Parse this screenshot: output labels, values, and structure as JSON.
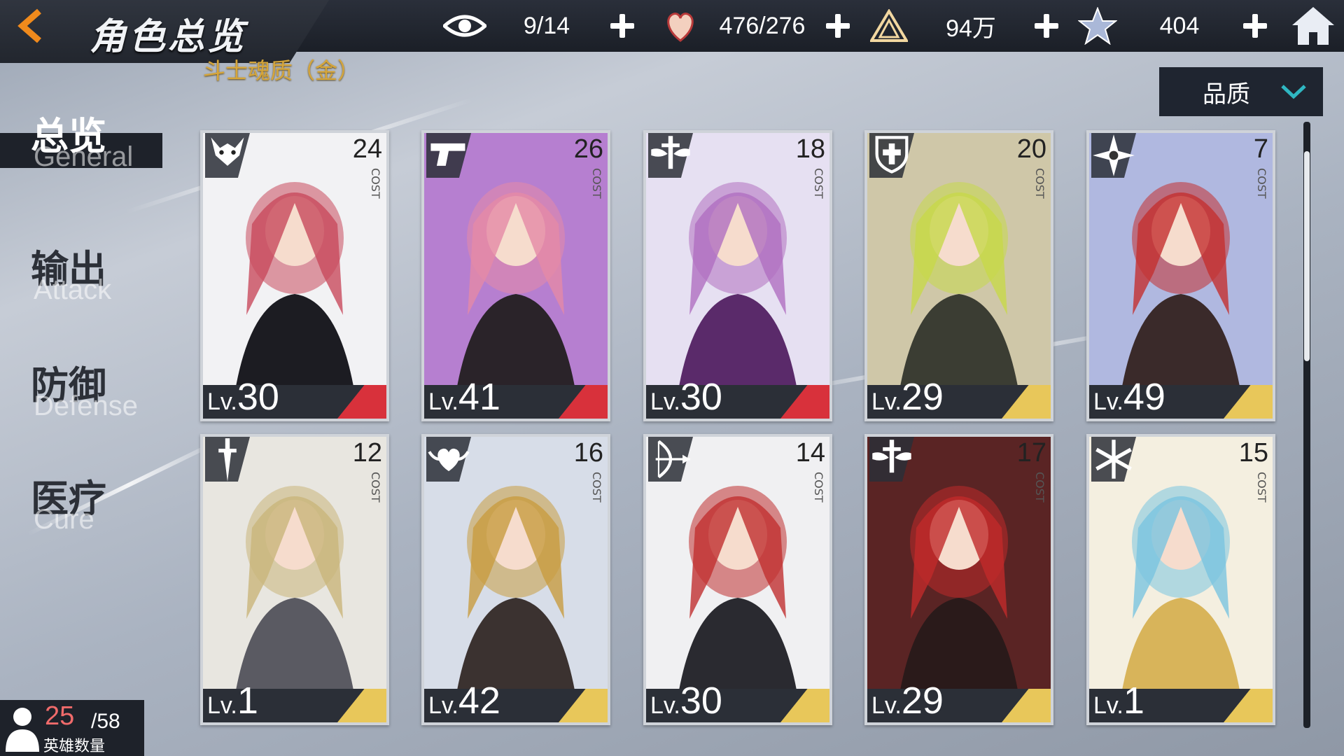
{
  "header": {
    "title": "角色总览",
    "subtitle": "斗士魂质（金）",
    "resources": [
      {
        "icon": "eye-icon",
        "value": "9/14"
      },
      {
        "icon": "heart-hand-icon",
        "value": "476/276"
      },
      {
        "icon": "triangle-crystal-icon",
        "value": "94万"
      },
      {
        "icon": "star-shard-icon",
        "value": "404"
      }
    ]
  },
  "filter": {
    "label": "品质"
  },
  "sidebar": {
    "tabs": [
      {
        "cn": "总览",
        "en": "General"
      },
      {
        "cn": "输出",
        "en": "Attack"
      },
      {
        "cn": "防御",
        "en": "Defense"
      },
      {
        "cn": "医疗",
        "en": "Cure"
      }
    ]
  },
  "cards": [
    {
      "level_prefix": "Lv.",
      "level": "30",
      "cost": "24",
      "cost_label": "COST",
      "class_icon": "demon-mask-icon",
      "rarity_color": "#d8313b",
      "art": [
        "#f2f2f4",
        "#1c1c22",
        "#c84a5c"
      ]
    },
    {
      "level_prefix": "Lv.",
      "level": "41",
      "cost": "26",
      "cost_label": "COST",
      "class_icon": "pistol-icon",
      "rarity_color": "#d8313b",
      "art": [
        "#b67fd0",
        "#2a2329",
        "#e58aa6"
      ]
    },
    {
      "level_prefix": "Lv.",
      "level": "30",
      "cost": "18",
      "cost_label": "COST",
      "class_icon": "winged-sword-icon",
      "rarity_color": "#d8313b",
      "art": [
        "#e6e0f2",
        "#5a2a6a",
        "#b06fc0"
      ]
    },
    {
      "level_prefix": "Lv.",
      "level": "29",
      "cost": "20",
      "cost_label": "COST",
      "class_icon": "cross-shield-icon",
      "rarity_color": "#e8c75a",
      "art": [
        "#cfc7a8",
        "#3b3d33",
        "#c7d84a"
      ]
    },
    {
      "level_prefix": "Lv.",
      "level": "49",
      "cost": "7",
      "cost_label": "COST",
      "class_icon": "shuriken-icon",
      "rarity_color": "#e8c75a",
      "art": [
        "#b0b8e0",
        "#3a2a2a",
        "#c43030"
      ]
    },
    {
      "level_prefix": "Lv.",
      "level": "1",
      "cost": "12",
      "cost_label": "COST",
      "class_icon": "dagger-icon",
      "rarity_color": "#e8c75a",
      "art": [
        "#e8e6e0",
        "#5a5a62",
        "#c9b57a"
      ]
    },
    {
      "level_prefix": "Lv.",
      "level": "42",
      "cost": "16",
      "cost_label": "COST",
      "class_icon": "winged-heart-icon",
      "rarity_color": "#e8c75a",
      "art": [
        "#d7dde8",
        "#3b3230",
        "#c89c40"
      ]
    },
    {
      "level_prefix": "Lv.",
      "level": "30",
      "cost": "14",
      "cost_label": "COST",
      "class_icon": "bow-icon",
      "rarity_color": "#e8c75a",
      "art": [
        "#f0f0f2",
        "#2a2a30",
        "#c03030"
      ]
    },
    {
      "level_prefix": "Lv.",
      "level": "29",
      "cost": "17",
      "cost_label": "COST",
      "class_icon": "winged-sword-icon",
      "rarity_color": "#e8c75a",
      "art": [
        "#5a2424",
        "#2a1a1a",
        "#c02a2a"
      ]
    },
    {
      "level_prefix": "Lv.",
      "level": "1",
      "cost": "15",
      "cost_label": "COST",
      "class_icon": "snowflake-icon",
      "rarity_color": "#e8c75a",
      "art": [
        "#f4efe0",
        "#d8b45a",
        "#7ac4e0"
      ]
    }
  ],
  "hero_count": {
    "owned": "25",
    "total": "/58",
    "label": "英雄数量"
  }
}
